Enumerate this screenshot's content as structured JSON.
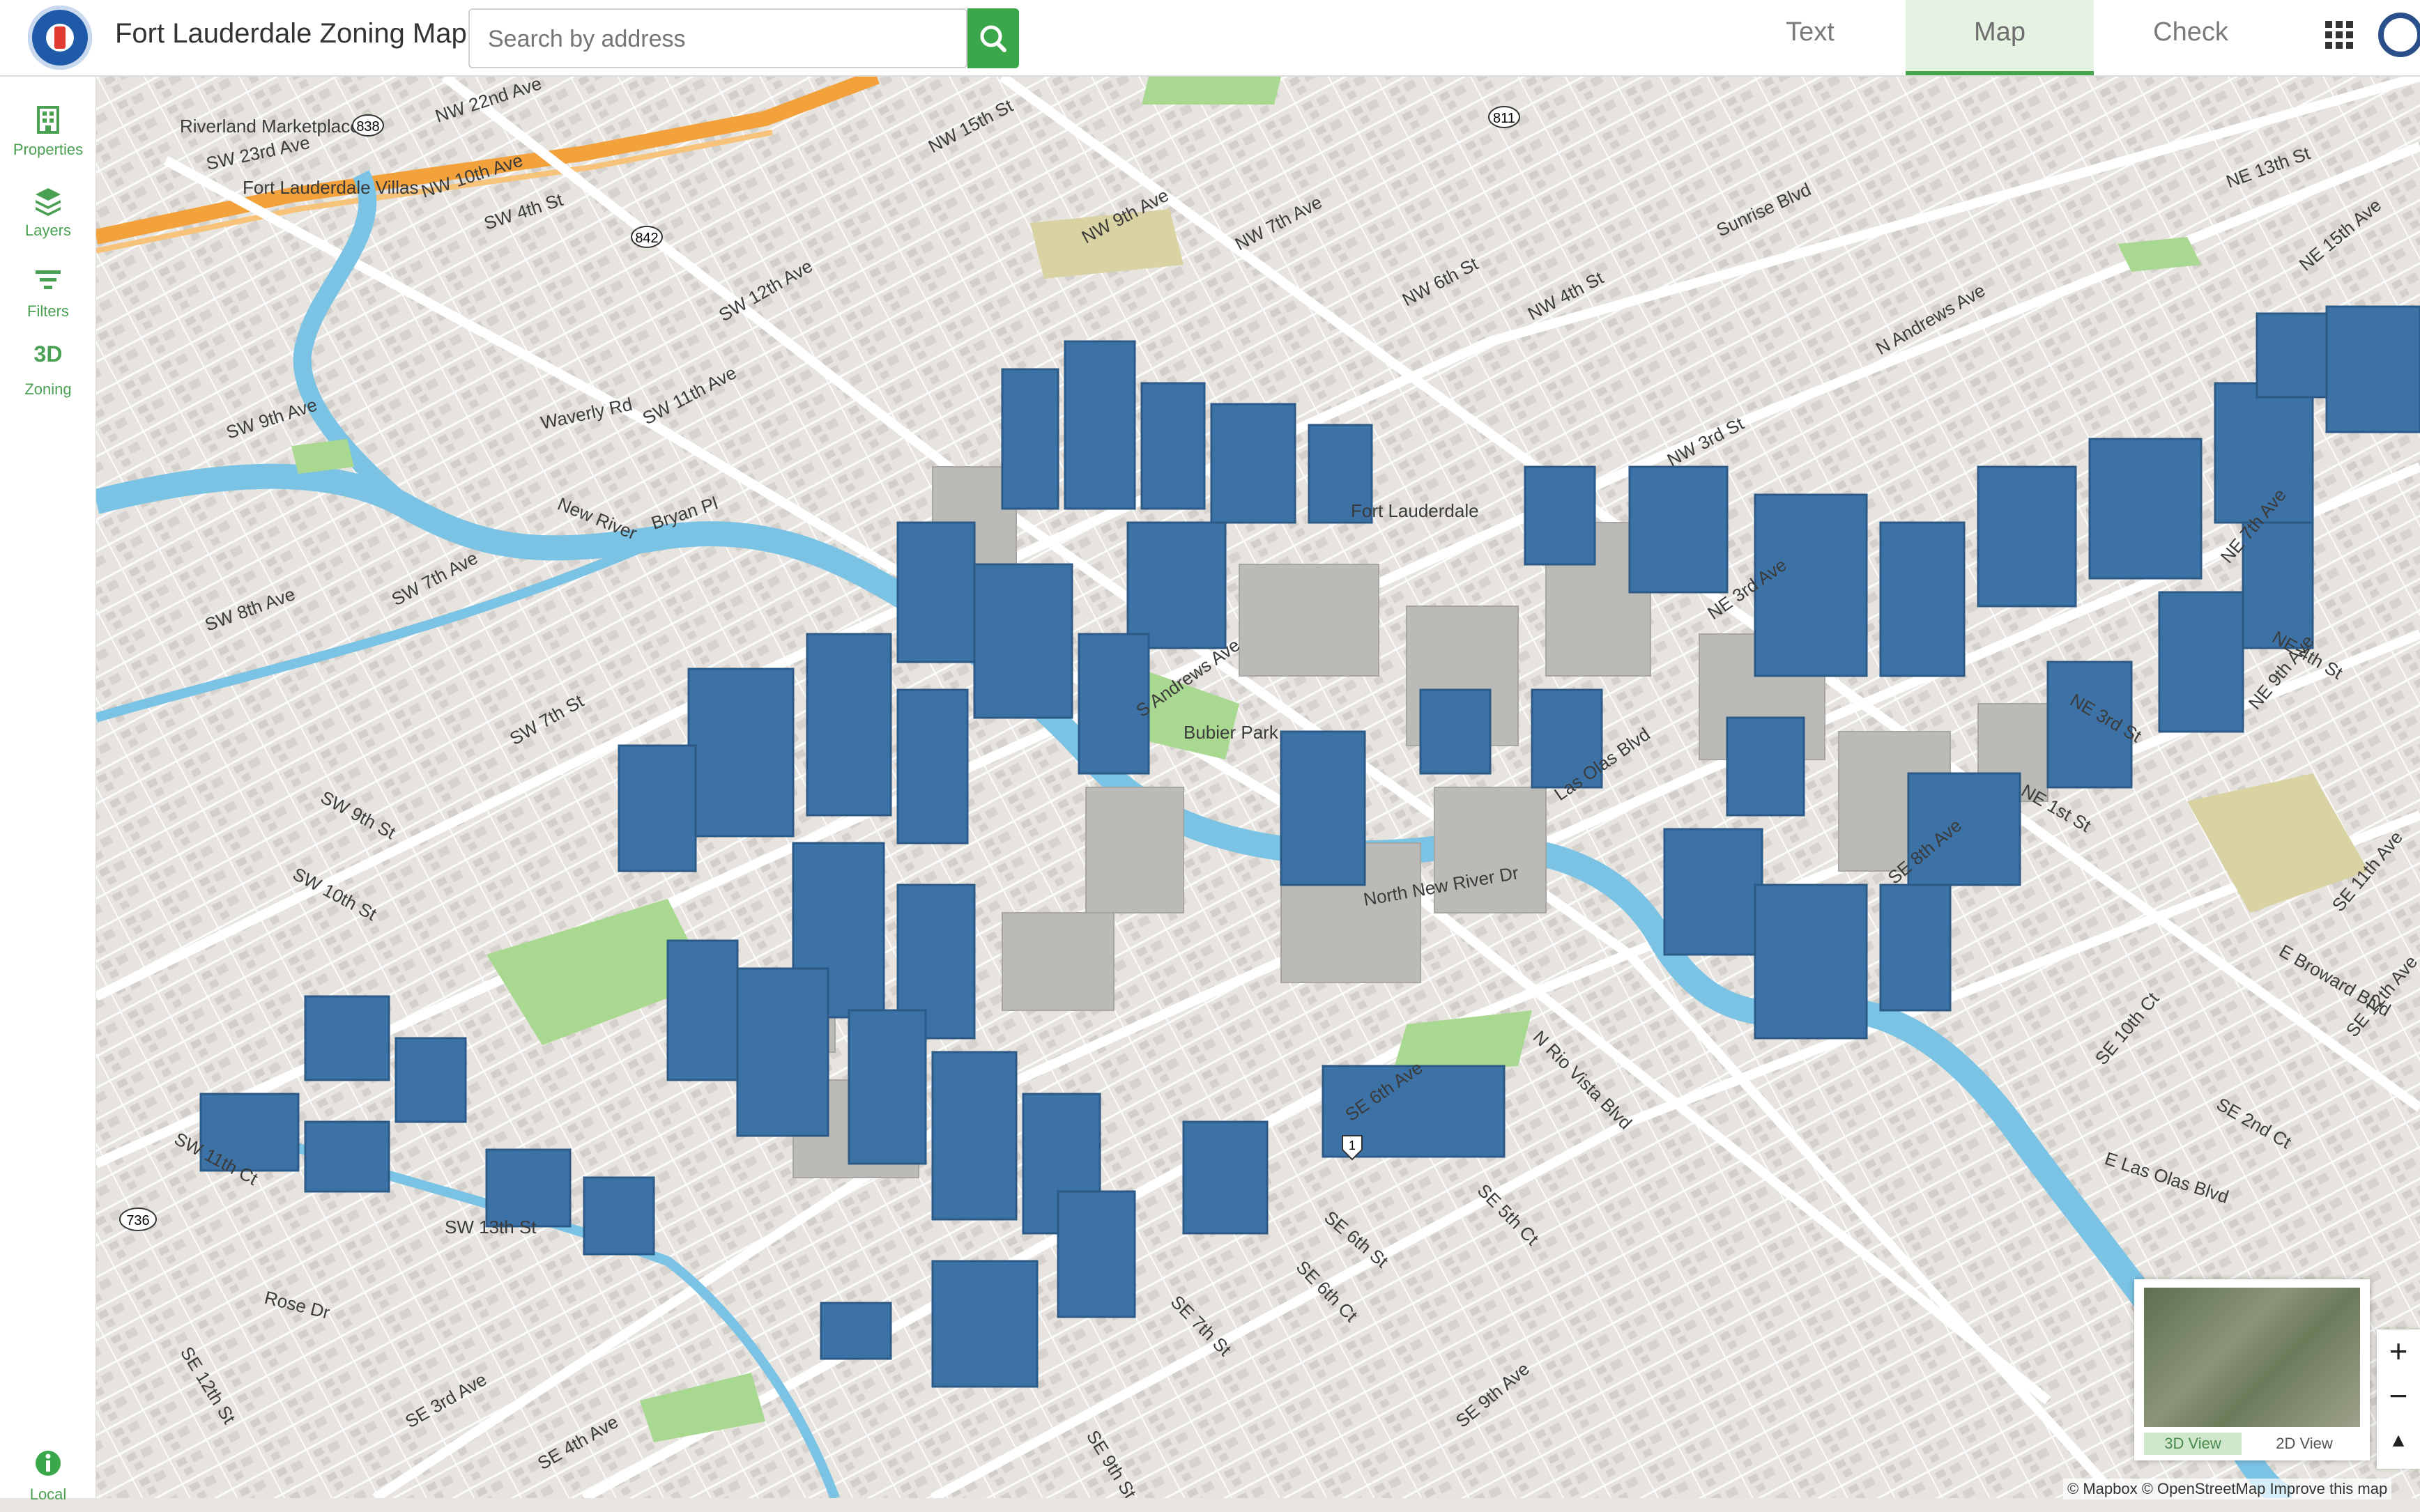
{
  "header": {
    "title": "Fort Lauderdale Zoning Map",
    "search_placeholder": "Search by address",
    "tabs": [
      {
        "label": "Text",
        "active": false
      },
      {
        "label": "Map",
        "active": true
      },
      {
        "label": "Check",
        "active": false
      }
    ]
  },
  "sidebar": {
    "items": [
      {
        "label": "Properties",
        "icon": "building-icon"
      },
      {
        "label": "Layers",
        "icon": "layers-icon"
      },
      {
        "label": "Filters",
        "icon": "filter-icon"
      },
      {
        "label": "Zoning",
        "icon_text": "3D"
      },
      {
        "label": "Local",
        "icon": "info-icon"
      }
    ]
  },
  "map": {
    "labels": [
      "NW 22nd Ave",
      "Riverland Marketplace",
      "SW 23rd Ave",
      "Fort Lauderdale Villas",
      "NW 10th Ave",
      "SW 4th St",
      "SW 12th Ave",
      "Waverly Rd",
      "New River",
      "SW 11th Ave",
      "Bryan Pl",
      "SW 9th Ave",
      "SW 7th Ave",
      "SW 8th Ave",
      "SW 7th St",
      "SW 9th St",
      "SW 10th St",
      "SW 11th Ct",
      "SW 13th St",
      "Rose Dr",
      "SE 12th St",
      "SE 3rd Ave",
      "SE 4th Ave",
      "SE 9th St",
      "SE 7th St",
      "SE 6th Ct",
      "SE 5th Ct",
      "SE 6th Ave",
      "SE 9th Ave",
      "SE 6th St",
      "N Rio Vista Blvd",
      "SE 8th Ave",
      "E Las Olas Blvd",
      "SE 2nd Ct",
      "SE 10th Ct",
      "SE 12th Ave",
      "E Broward Blvd",
      "SE 11th Ave",
      "NE 1st St",
      "NE 3rd St",
      "NE 9th Ave",
      "NE 7th Ave",
      "NE 4th St",
      "NE 15th Ave",
      "NE 13th St",
      "N Andrews Ave",
      "Sunrise Blvd",
      "NW 6th St",
      "NW 7th Ave",
      "NW 9th Ave",
      "NW 4th St",
      "NW 15th St",
      "S Andrews Ave",
      "North New River Dr",
      "Fort Lauderdale",
      "Bubier Park",
      "Las Olas Blvd",
      "NE 3rd Ave",
      "NW 3rd St"
    ],
    "route_shields": [
      "838",
      "842",
      "811",
      "1",
      "736"
    ],
    "minimap_buttons": [
      {
        "label": "3D View",
        "active": true
      },
      {
        "label": "2D View",
        "active": false
      }
    ],
    "zoom_in": "+",
    "zoom_out": "−",
    "compass": "▲",
    "attribution": "© Mapbox © OpenStreetMap Improve this map",
    "provider": "mapbox"
  },
  "colors": {
    "accent_green": "#3aa74a",
    "building_blue": "#3c72a6",
    "water": "#7bc3e4",
    "park": "#a9d890",
    "land": "#e9e6e1"
  }
}
